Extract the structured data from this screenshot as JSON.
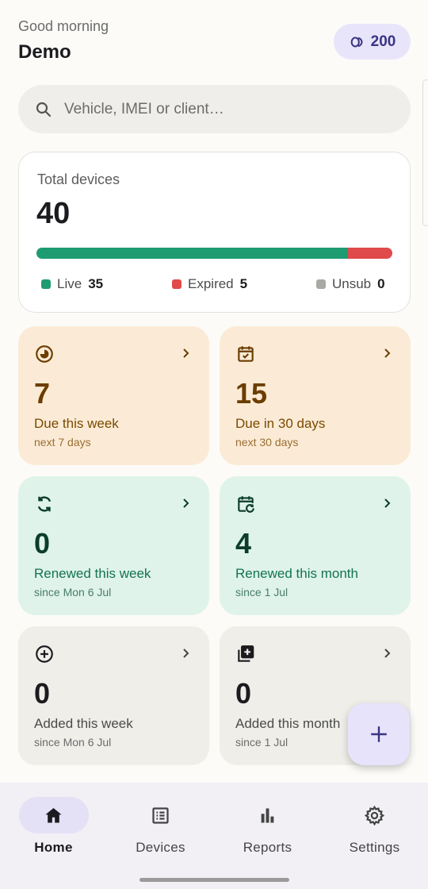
{
  "header": {
    "greeting": "Good morning",
    "username": "Demo",
    "credits": "200",
    "credits_icon": "coins-icon"
  },
  "search": {
    "placeholder": "Vehicle, IMEI or client…",
    "icon": "search-icon"
  },
  "total": {
    "label": "Total devices",
    "value": "40",
    "live_fraction": 0.875,
    "expired_fraction": 0.125,
    "legend": [
      {
        "label": "Live",
        "value": "35",
        "color": "#1f9b72"
      },
      {
        "label": "Expired",
        "value": "5",
        "color": "#e04a4a"
      },
      {
        "label": "Unsub",
        "value": "0",
        "color": "#a8a8a4"
      }
    ]
  },
  "tiles": [
    {
      "value": "7",
      "title": "Due this week",
      "subtitle": "next 7 days",
      "icon": "clock-pie-icon",
      "tone": "orange"
    },
    {
      "value": "15",
      "title": "Due in 30 days",
      "subtitle": "next 30 days",
      "icon": "calendar-check-icon",
      "tone": "orange"
    },
    {
      "value": "0",
      "title": "Renewed this week",
      "subtitle": "since Mon 6 Jul",
      "icon": "sync-icon",
      "tone": "green"
    },
    {
      "value": "4",
      "title": "Renewed this month",
      "subtitle": "since 1 Jul",
      "icon": "calendar-refresh-icon",
      "tone": "green"
    },
    {
      "value": "0",
      "title": "Added this week",
      "subtitle": "since Mon 6 Jul",
      "icon": "add-circle-icon",
      "tone": "grey"
    },
    {
      "value": "0",
      "title": "Added this month",
      "subtitle": "since 1 Jul",
      "icon": "library-add-icon",
      "tone": "grey"
    }
  ],
  "fab": {
    "icon": "plus-icon"
  },
  "nav": {
    "items": [
      {
        "label": "Home",
        "icon": "home-icon",
        "active": true
      },
      {
        "label": "Devices",
        "icon": "list-icon",
        "active": false
      },
      {
        "label": "Reports",
        "icon": "bar-chart-icon",
        "active": false
      },
      {
        "label": "Settings",
        "icon": "gear-icon",
        "active": false
      }
    ]
  },
  "colors": {
    "accent": "#3a3582",
    "live": "#1f9b72",
    "expired": "#e04a4a",
    "orange_tile": "#fbebd6",
    "green_tile": "#dff3ea",
    "grey_tile": "#efeee9"
  }
}
